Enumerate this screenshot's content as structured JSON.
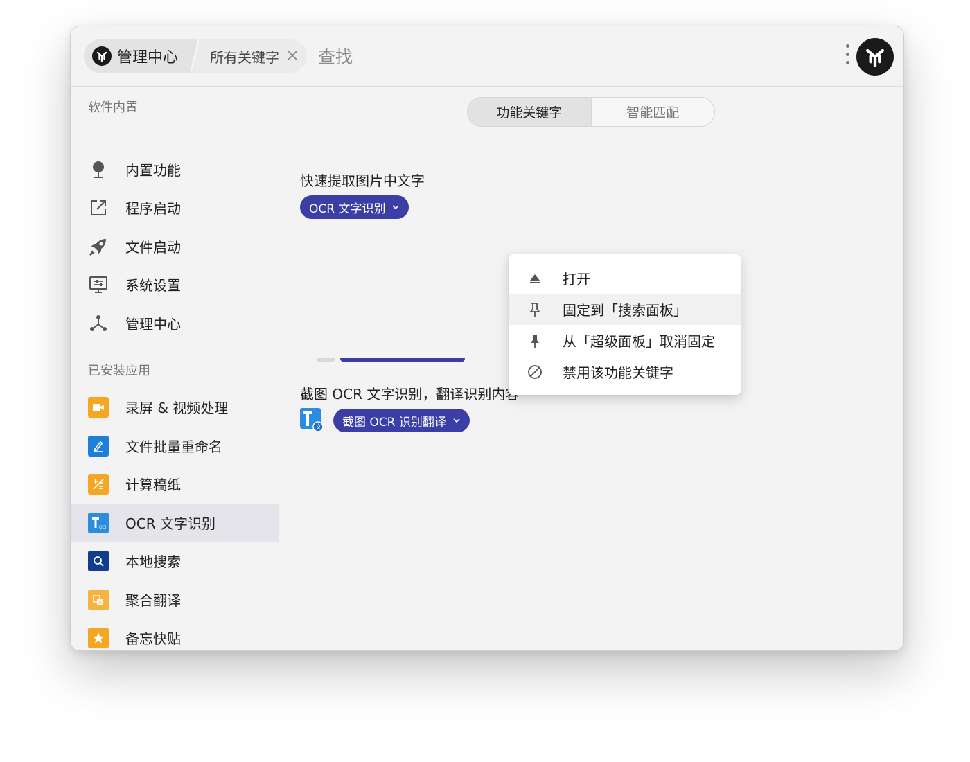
{
  "titlebar": {
    "breadcrumb_main": "管理中心",
    "breadcrumb_sub": "所有关键字",
    "search_placeholder": "查找"
  },
  "sidebar": {
    "builtin_title": "软件内置",
    "builtin_items": [
      {
        "label": "内置功能",
        "icon": "pin-ball-icon"
      },
      {
        "label": "程序启动",
        "icon": "external-link-icon"
      },
      {
        "label": "文件启动",
        "icon": "rocket-icon"
      },
      {
        "label": "系统设置",
        "icon": "monitor-settings-icon"
      },
      {
        "label": "管理中心",
        "icon": "network-icon"
      }
    ],
    "installed_title": "已安装应用",
    "installed_items": [
      {
        "label": "录屏 & 视频处理",
        "icon": "video-camera-icon",
        "color": "#f5a623"
      },
      {
        "label": "文件批量重命名",
        "icon": "pencil-icon",
        "color": "#1f7fd8"
      },
      {
        "label": "计算稿纸",
        "icon": "calculator-icon",
        "color": "#f5a623"
      },
      {
        "label": "OCR 文字识别",
        "icon": "ocr-icon",
        "color": "#2a8de0",
        "active": true
      },
      {
        "label": "本地搜索",
        "icon": "magnifier-icon",
        "color": "#123d8c"
      },
      {
        "label": "聚合翻译",
        "icon": "translate-icon",
        "color": "#f7b340"
      },
      {
        "label": "备忘快贴",
        "icon": "star-note-icon",
        "color": "#f5a623"
      }
    ]
  },
  "main": {
    "tabs": [
      "功能关键字",
      "智能匹配"
    ],
    "groups": [
      {
        "title": "快速提取图片中文字",
        "chip": "OCR 文字识别"
      },
      {
        "title": "截图 OCR 文字识别，翻译识别内容",
        "chip": "截图 OCR 识别翻译"
      }
    ]
  },
  "context_menu": {
    "items": [
      {
        "label": "打开",
        "icon": "eject-icon"
      },
      {
        "label": "固定到「搜索面板」",
        "icon": "pin-outline-icon"
      },
      {
        "label": "从「超级面板」取消固定",
        "icon": "pin-filled-icon"
      },
      {
        "label": "禁用该功能关键字",
        "icon": "block-icon"
      }
    ]
  },
  "colors": {
    "accent": "#3b3fa5",
    "window_bg": "#f3f3f3",
    "active_item_bg": "#e4e4ea"
  }
}
